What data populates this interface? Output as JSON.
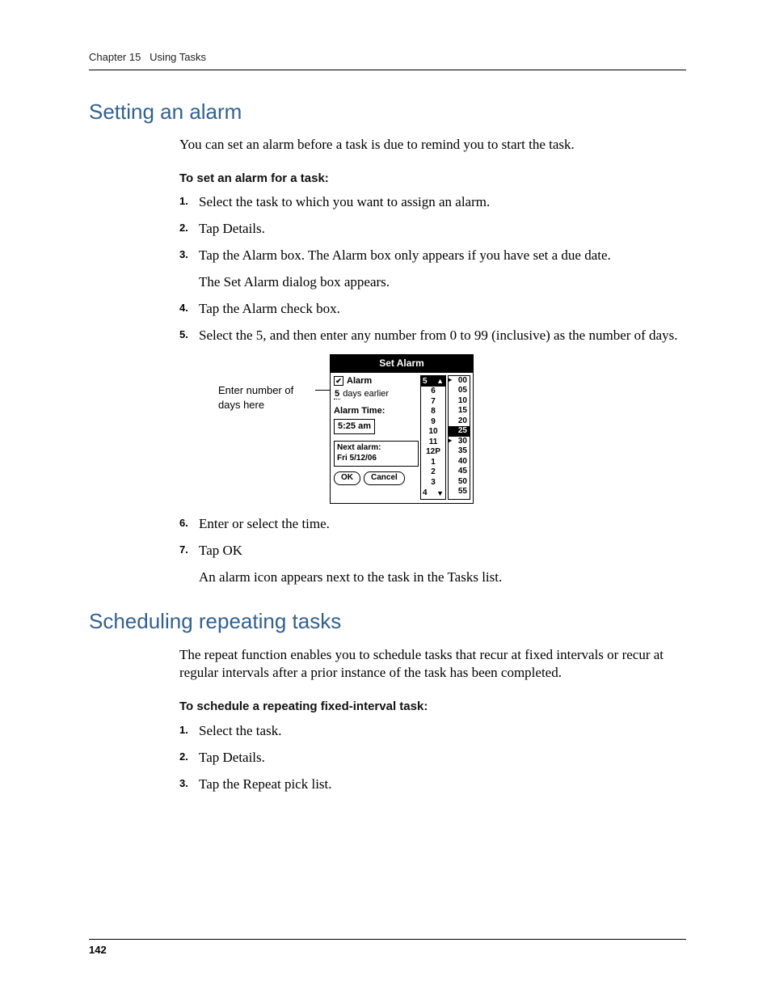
{
  "runningHead": {
    "chapter": "Chapter 15",
    "title": "Using Tasks"
  },
  "section1": {
    "heading": "Setting an alarm",
    "lead": "You can set an alarm before a task is due to remind you to start the task.",
    "subhead": "To set an alarm for a task:",
    "steps": {
      "s1": "Select the task to which you want to assign an alarm.",
      "s2": "Tap Details.",
      "s3a": "Tap the Alarm box. The Alarm box only appears if you have set a due date.",
      "s3b": "The Set Alarm dialog box appears.",
      "s4": "Tap the Alarm check box.",
      "s5": "Select the 5, and then enter any number from 0 to 99 (inclusive) as the number of days.",
      "s6": "Enter or select the time.",
      "s7a": "Tap OK",
      "s7b": "An alarm icon appears next to the task in the Tasks list."
    },
    "callout": "Enter number of days here"
  },
  "dialog": {
    "title": "Set Alarm",
    "alarmLabel": "Alarm",
    "daysValue": "5",
    "daysSuffix": "days earlier",
    "alarmTimeLabel": "Alarm Time:",
    "alarmTimeValue": "5:25 am",
    "nextAlarmLabel": "Next alarm:",
    "nextAlarmValue": "Fri 5/12/06",
    "okLabel": "OK",
    "cancelLabel": "Cancel",
    "hours": {
      "sel": "5",
      "r1": "6",
      "r2": "7",
      "r3": "8",
      "r4": "9",
      "r5": "10",
      "r6": "11",
      "r7": "12P",
      "r8": "1",
      "r9": "2",
      "r10": "3",
      "last": "4"
    },
    "mins": {
      "m0": "00",
      "m1": "05",
      "m2": "10",
      "m3": "15",
      "m4": "20",
      "m5": "25",
      "m6": "30",
      "m7": "35",
      "m8": "40",
      "m9": "45",
      "m10": "50",
      "m11": "55"
    }
  },
  "section2": {
    "heading": "Scheduling repeating tasks",
    "lead": "The repeat function enables you to schedule tasks that recur at fixed intervals or recur at regular intervals after a prior instance of the task has been completed.",
    "subhead": "To schedule a repeating fixed-interval task:",
    "steps": {
      "s1": "Select the task.",
      "s2": "Tap Details.",
      "s3": "Tap the Repeat pick list."
    }
  },
  "pageNumber": "142"
}
